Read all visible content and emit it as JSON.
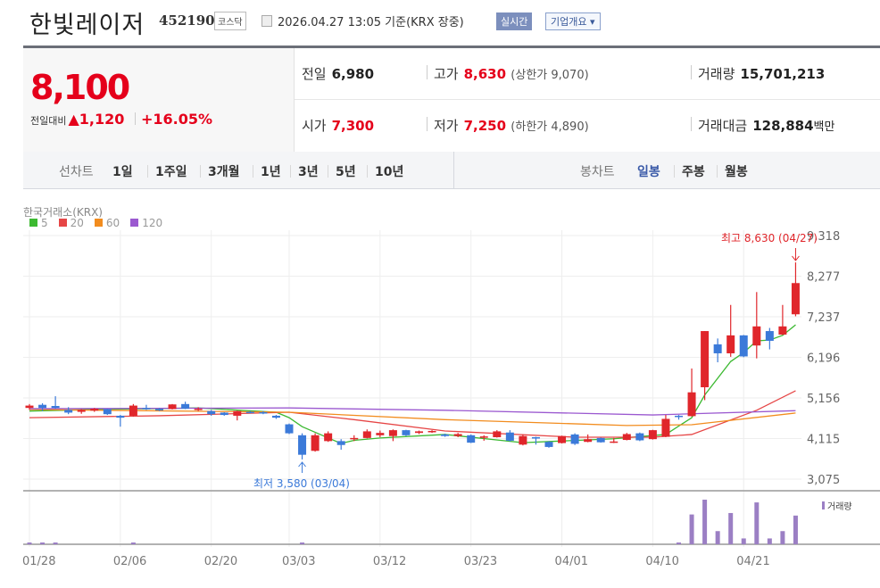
{
  "header": {
    "name": "한빛레이저",
    "code": "452190",
    "market": "코스닥",
    "datetime": "2026.04.27 13:05 기준(KRX 장중)",
    "realtime": "실시간",
    "company": "기업개요 ▾"
  },
  "quote": {
    "price": "8,100",
    "change_label": "전일대비",
    "change_arrow": "▲",
    "change": "1,120",
    "change_pct": "+16.05%",
    "prev_label": "전일",
    "prev": "6,980",
    "high_label": "고가",
    "high": "8,630",
    "upper_limit": "(상한가 9,070)",
    "volume_label": "거래량",
    "volume": "15,701,213",
    "open_label": "시가",
    "open": "7,300",
    "low_label": "저가",
    "low": "7,250",
    "lower_limit": "(하한가 4,890)",
    "amount_label": "거래대금",
    "amount": "128,884",
    "amount_unit": "백만"
  },
  "tabs": {
    "line_label": "선차트",
    "line": [
      "1일",
      "1주일",
      "3개월",
      "1년",
      "3년",
      "5년",
      "10년"
    ],
    "candle_label": "봉차트",
    "candle": [
      "일봉",
      "주봉",
      "월봉"
    ],
    "active": "일봉"
  },
  "chart_data": {
    "type": "candlestick",
    "source": "한국거래소(KRX)",
    "legend": [
      {
        "name": "5",
        "color": "#3cb931"
      },
      {
        "name": "20",
        "color": "#e64646"
      },
      {
        "name": "60",
        "color": "#f28c1e"
      },
      {
        "name": "120",
        "color": "#9b59d0"
      }
    ],
    "ylim": [
      3075,
      9318
    ],
    "yticks": [
      "9,318",
      "8,277",
      "7,237",
      "6,196",
      "5,156",
      "4,115",
      "3,075"
    ],
    "ytick_values": [
      9318,
      8277,
      7237,
      6196,
      5156,
      4115,
      3075
    ],
    "xticks": [
      {
        "i": 0,
        "label": "01/28"
      },
      {
        "i": 7,
        "label": "02/06"
      },
      {
        "i": 14,
        "label": "02/20"
      },
      {
        "i": 20,
        "label": "03/03"
      },
      {
        "i": 27,
        "label": "03/12"
      },
      {
        "i": 34,
        "label": "03/23"
      },
      {
        "i": 41,
        "label": "04/01"
      },
      {
        "i": 48,
        "label": "04/10"
      },
      {
        "i": 55,
        "label": "04/21"
      }
    ],
    "ohlc": [
      [
        4900,
        5000,
        4850,
        4960
      ],
      [
        4980,
        5020,
        4820,
        4900
      ],
      [
        4950,
        5200,
        4880,
        4900
      ],
      [
        4850,
        4920,
        4740,
        4780
      ],
      [
        4800,
        4870,
        4750,
        4850
      ],
      [
        4830,
        4900,
        4800,
        4880
      ],
      [
        4870,
        4880,
        4720,
        4740
      ],
      [
        4700,
        4720,
        4420,
        4650
      ],
      [
        4700,
        5000,
        4680,
        4960
      ],
      [
        4900,
        4980,
        4850,
        4870
      ],
      [
        4870,
        4900,
        4820,
        4850
      ],
      [
        4870,
        5000,
        4860,
        4990
      ],
      [
        5000,
        5060,
        4870,
        4880
      ],
      [
        4850,
        4920,
        4820,
        4880
      ],
      [
        4820,
        4850,
        4700,
        4740
      ],
      [
        4780,
        4790,
        4700,
        4720
      ],
      [
        4700,
        4830,
        4580,
        4820
      ],
      [
        4800,
        4820,
        4760,
        4780
      ],
      [
        4790,
        4820,
        4740,
        4780
      ],
      [
        4700,
        4720,
        4620,
        4650
      ],
      [
        4480,
        4500,
        4230,
        4250
      ],
      [
        4200,
        4250,
        3580,
        3700
      ],
      [
        3800,
        4250,
        3780,
        4200
      ],
      [
        4050,
        4300,
        4030,
        4250
      ],
      [
        4050,
        4100,
        3830,
        3950
      ],
      [
        4100,
        4200,
        4050,
        4130
      ],
      [
        4130,
        4350,
        4120,
        4300
      ],
      [
        4200,
        4320,
        4150,
        4260
      ],
      [
        4180,
        4350,
        4050,
        4330
      ],
      [
        4330,
        4340,
        4180,
        4200
      ],
      [
        4260,
        4320,
        4230,
        4300
      ],
      [
        4280,
        4330,
        4260,
        4310
      ],
      [
        4220,
        4240,
        4160,
        4180
      ],
      [
        4180,
        4260,
        4150,
        4230
      ],
      [
        4200,
        4220,
        4000,
        4010
      ],
      [
        4150,
        4200,
        4060,
        4170
      ],
      [
        4150,
        4330,
        4140,
        4300
      ],
      [
        4270,
        4330,
        4040,
        4060
      ],
      [
        3960,
        4220,
        3940,
        4180
      ],
      [
        4150,
        4160,
        3960,
        4130
      ],
      [
        4030,
        4050,
        3880,
        3900
      ],
      [
        4000,
        4190,
        3990,
        4180
      ],
      [
        4220,
        4250,
        3950,
        3980
      ],
      [
        4030,
        4220,
        4020,
        4100
      ],
      [
        4130,
        4140,
        4010,
        4020
      ],
      [
        4020,
        4130,
        4000,
        4040
      ],
      [
        4080,
        4260,
        4070,
        4230
      ],
      [
        4250,
        4270,
        4050,
        4070
      ],
      [
        4100,
        4340,
        4090,
        4330
      ],
      [
        4160,
        4720,
        4150,
        4620
      ],
      [
        4700,
        4720,
        4600,
        4680
      ],
      [
        4690,
        5910,
        4680,
        5300
      ],
      [
        5430,
        6870,
        5100,
        6870
      ],
      [
        6530,
        6680,
        6070,
        6300
      ],
      [
        6300,
        7540,
        6210,
        6760
      ],
      [
        6760,
        6770,
        6200,
        6220
      ],
      [
        6500,
        7870,
        6170,
        6990
      ],
      [
        6870,
        6950,
        6400,
        6620
      ],
      [
        6780,
        7540,
        6770,
        6990
      ],
      [
        7300,
        8630,
        7250,
        8100
      ]
    ],
    "ma": {
      "5": [
        [
          0,
          4820
        ],
        [
          5,
          4860
        ],
        [
          13,
          4900
        ],
        [
          19,
          4790
        ],
        [
          20,
          4650
        ],
        [
          21,
          4420
        ],
        [
          24,
          3990
        ],
        [
          25,
          4070
        ],
        [
          27,
          4130
        ],
        [
          32,
          4220
        ],
        [
          38,
          4010
        ],
        [
          45,
          4110
        ],
        [
          49,
          4220
        ],
        [
          51,
          4650
        ],
        [
          52,
          5230
        ],
        [
          54,
          6090
        ],
        [
          55,
          6320
        ],
        [
          56,
          6620
        ],
        [
          57,
          6640
        ],
        [
          58,
          6760
        ],
        [
          59,
          7030
        ]
      ],
      "20": [
        [
          0,
          4650
        ],
        [
          10,
          4700
        ],
        [
          20,
          4790
        ],
        [
          25,
          4600
        ],
        [
          32,
          4310
        ],
        [
          42,
          4150
        ],
        [
          48,
          4150
        ],
        [
          51,
          4220
        ],
        [
          56,
          4840
        ],
        [
          59,
          5340
        ]
      ],
      "60": [
        [
          0,
          4860
        ],
        [
          20,
          4790
        ],
        [
          32,
          4600
        ],
        [
          46,
          4450
        ],
        [
          51,
          4470
        ],
        [
          59,
          4770
        ]
      ],
      "120": [
        [
          0,
          4880
        ],
        [
          20,
          4900
        ],
        [
          32,
          4840
        ],
        [
          48,
          4720
        ],
        [
          59,
          4830
        ]
      ]
    },
    "volume_label": "거래량",
    "volume_millions": {
      "0": 0.8,
      "1": 0.8,
      "2": 0.8,
      "8": 0.8,
      "21": 0.8,
      "50": 0.8,
      "51": 16.3,
      "52": 24.4,
      "53": 7.2,
      "54": 17.1,
      "55": 3.2,
      "56": 22.9,
      "57": 3.2,
      "58": 7.2,
      "59": 15.7
    },
    "annotations": {
      "high": "최고 8,630 (04/27)",
      "low": "최저 3,580 (03/04)"
    },
    "up_color": "#e0262b",
    "down_color": "#3b7ad9"
  }
}
